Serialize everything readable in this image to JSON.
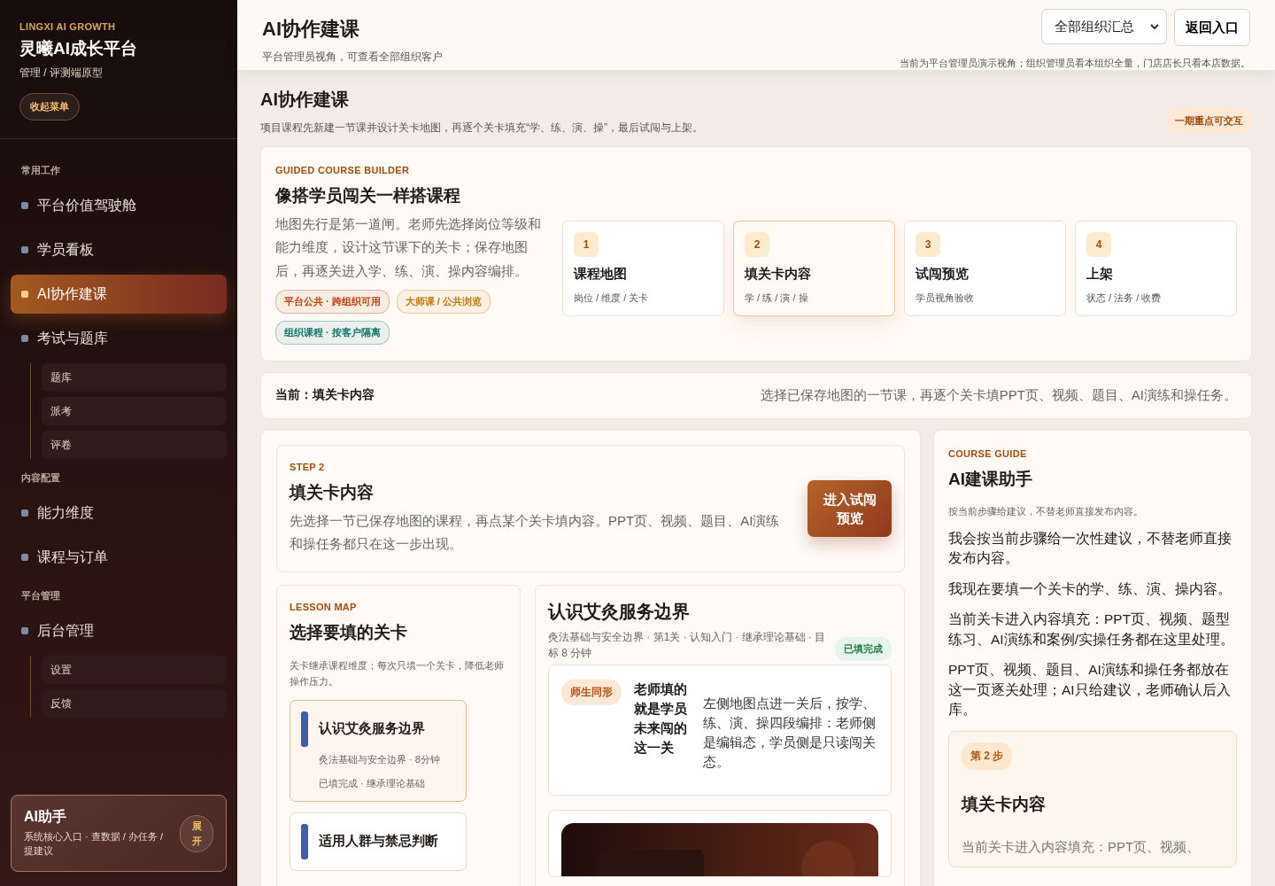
{
  "sidebar": {
    "brand_en": "LINGXI AI GROWTH",
    "brand": "灵曦AI成长平台",
    "subtitle": "管理 / 评测端原型",
    "collapse_button": "收起菜单",
    "sections": [
      {
        "title": "常用工作",
        "items": [
          {
            "label": "平台价值驾驶舱",
            "selected": false
          },
          {
            "label": "学员看板",
            "selected": false
          },
          {
            "label": "AI协作建课",
            "selected": true
          },
          {
            "label": "考试与题库",
            "selected": false,
            "children": [
              {
                "label": "题库"
              },
              {
                "label": "派考"
              },
              {
                "label": "评卷"
              }
            ]
          }
        ]
      },
      {
        "title": "内容配置",
        "items": [
          {
            "label": "能力维度",
            "selected": false
          },
          {
            "label": "课程与订单",
            "selected": false
          }
        ]
      },
      {
        "title": "平台管理",
        "items": [
          {
            "label": "后台管理",
            "selected": false,
            "children": [
              {
                "label": "设置"
              },
              {
                "label": "反馈"
              }
            ]
          }
        ]
      }
    ],
    "assistant": {
      "title": "AI助手",
      "desc": "系统核心入口 · 查数据 / 办任务 / 提建议",
      "button": "展开"
    }
  },
  "header": {
    "title": "AI协作建课",
    "subtitle": "平台管理员视角，可查看全部组织客户",
    "org_select": "全部组织汇总",
    "back_button": "返回入口",
    "note": "当前为平台管理员演示视角；组织管理员看本组织全量，门店店长只看本店数据。"
  },
  "page": {
    "title": "AI协作建课",
    "desc": "项目课程先新建一节课并设计关卡地图，再逐个关卡填充“学、练、演、操”，最后试闯与上架。",
    "badge": "一期重点可交互"
  },
  "builder": {
    "eyebrow": "GUIDED COURSE BUILDER",
    "title": "像搭学员闯关一样搭课程",
    "desc": "地图先行是第一道闸。老师先选择岗位等级和能力维度，设计这节课下的关卡；保存地图后，再逐关进入学、练、演、操内容编排。",
    "tags": [
      {
        "label": "平台公共 · 跨组织可用",
        "color": "#c2410c"
      },
      {
        "label": "大师课 / 公共浏览",
        "color": "#c27a0e"
      },
      {
        "label": "组织课程 · 按客户隔离",
        "color": "#0f766e"
      }
    ],
    "steps": [
      {
        "number": "1",
        "title": "课程地图",
        "sub": "岗位 / 维度 / 关卡",
        "selected": false
      },
      {
        "number": "2",
        "title": "填关卡内容",
        "sub": "学 / 练 / 演 / 操",
        "selected": true
      },
      {
        "number": "3",
        "title": "试闯预览",
        "sub": "学员视角验收",
        "selected": false
      },
      {
        "number": "4",
        "title": "上架",
        "sub": "状态 / 法务 / 收费",
        "selected": false
      }
    ]
  },
  "current_bar": {
    "label": "当前：填关卡内容",
    "hint": "选择已保存地图的一节课，再逐个关卡填PPT页、视频、题目、AI演练和操任务。"
  },
  "step_panel": {
    "eyebrow": "STEP 2",
    "title": "填关卡内容",
    "desc": "先选择一节已保存地图的课程，再点某个关卡填内容。PPT页、视频、题目、AI演练和操任务都只在这一步出现。",
    "button": "进入试闯预览"
  },
  "lesson_map": {
    "eyebrow": "LESSON MAP",
    "title": "选择要填的关卡",
    "desc": "关卡继承课程维度；每次只填一个关卡，降低老师操作压力。",
    "lessons": [
      {
        "title": "认识艾灸服务边界",
        "meta": "灸法基础与安全边界 · 8分钟",
        "status": "已填完成 · 继承理论基础",
        "selected": true
      },
      {
        "title": "适用人群与禁忌判断",
        "selected": false
      }
    ]
  },
  "detail": {
    "title": "认识艾灸服务边界",
    "meta": "灸法基础与安全边界 · 第1关 · 认知入门 · 继承理论基础 · 目标 8 分钟",
    "status": "已填完成",
    "callout": {
      "tag": "师生同形",
      "heading": "老师填的就是学员未来闯的这一关",
      "body": "左侧地图点进一关后，按学、练、演、操四段编排：老师侧是编辑态，学员侧是只读闯关态。"
    }
  },
  "guide": {
    "eyebrow": "COURSE GUIDE",
    "title": "AI建课助手",
    "note": "按当前步骤给建议，不替老师直接发布内容。",
    "paragraphs": [
      "我会按当前步骤给一次性建议，不替老师直接发布内容。",
      "我现在要填一个关卡的学、练、演、操内容。",
      "当前关卡进入内容填充：PPT页、视频、题型练习、AI演练和案例/实操任务都在这里处理。",
      "PPT页、视频、题目、AI演练和操任务都放在这一页逐关处理；AI只给建议，老师确认后入库。"
    ],
    "step_card": {
      "badge": "第 2 步",
      "title": "填关卡内容",
      "body": "当前关卡进入内容填充：PPT页、视频、"
    }
  }
}
